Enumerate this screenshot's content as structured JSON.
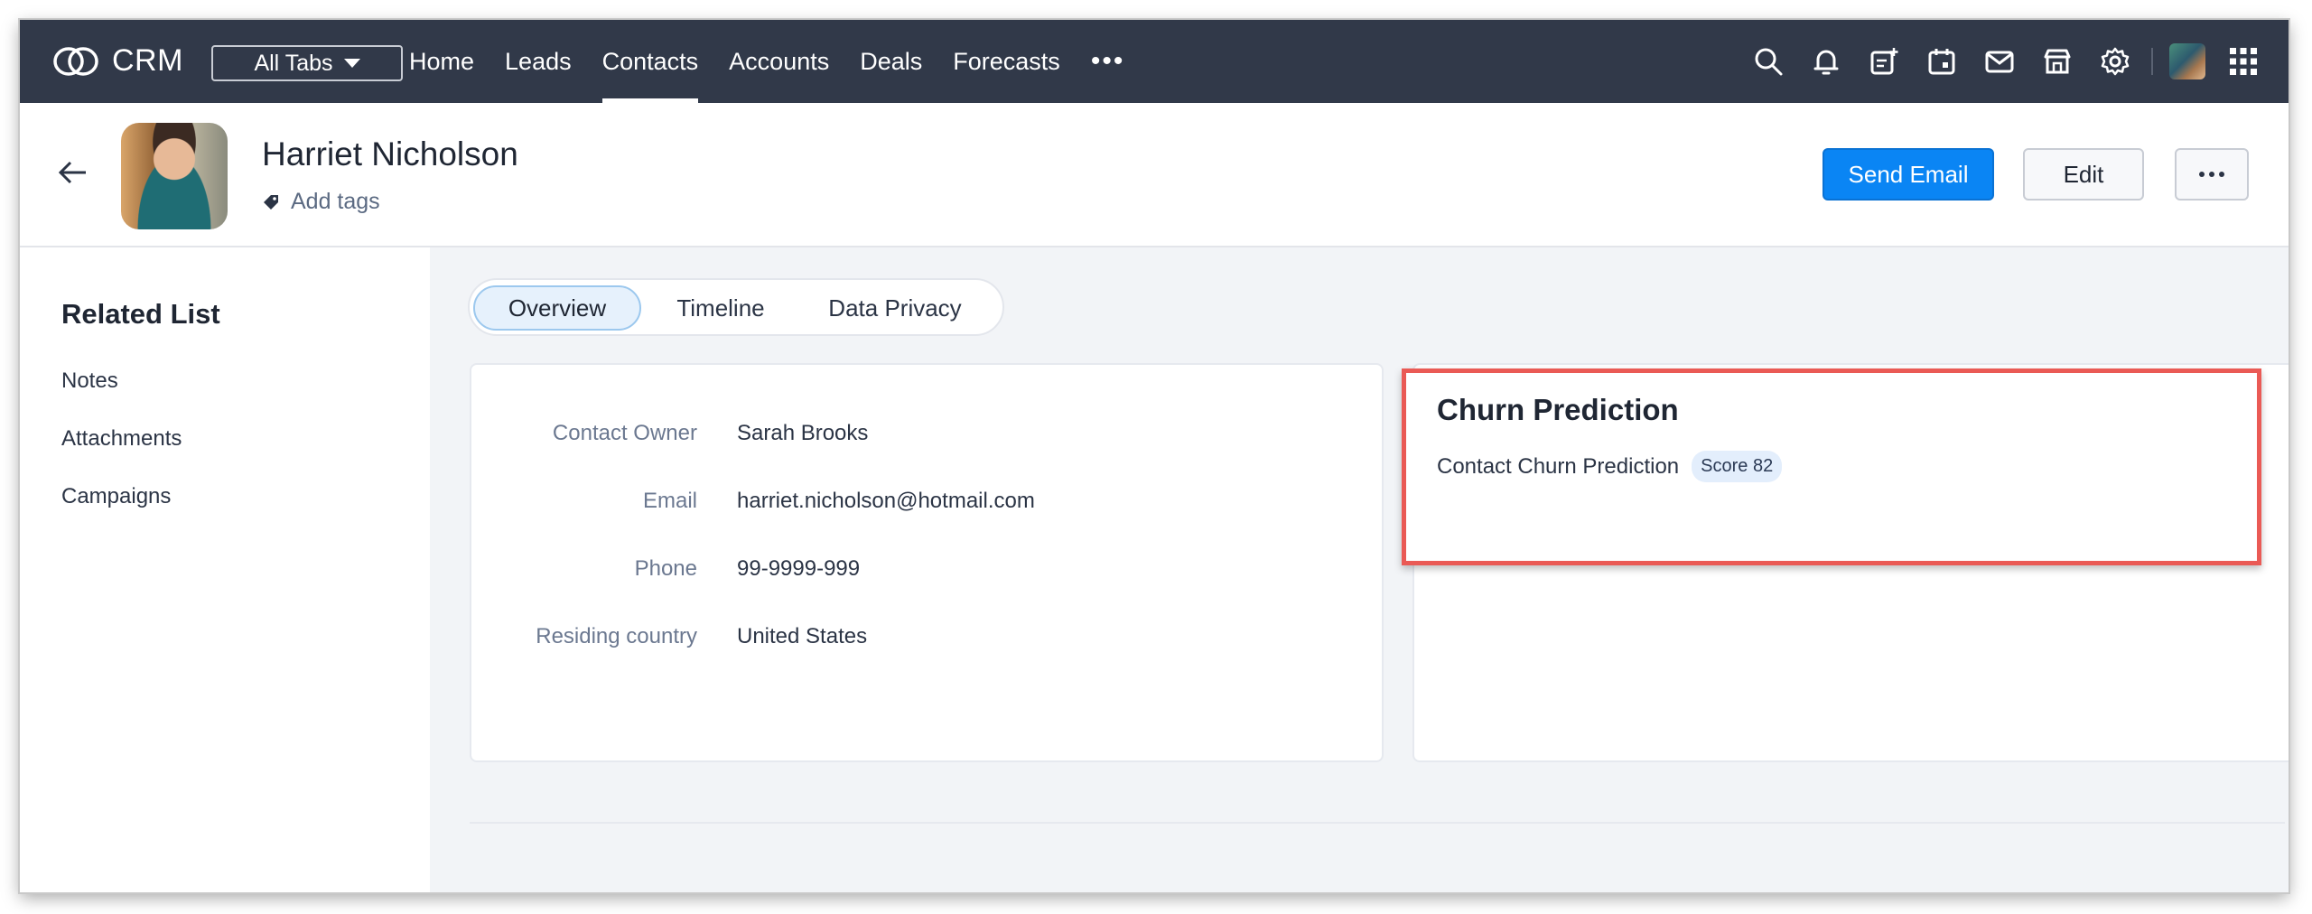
{
  "app": {
    "logo_text": "CRM"
  },
  "topnav": {
    "all_tabs_label": "All Tabs",
    "items": [
      {
        "label": "Home"
      },
      {
        "label": "Leads"
      },
      {
        "label": "Contacts"
      },
      {
        "label": "Accounts"
      },
      {
        "label": "Deals"
      },
      {
        "label": "Forecasts"
      }
    ],
    "more_label": "•••",
    "active": "Contacts",
    "icons": [
      "search-icon",
      "bell-icon",
      "add-note-icon",
      "calendar-icon",
      "mail-icon",
      "marketplace-icon",
      "gear-icon",
      "profile-avatar",
      "apps-grid-icon"
    ]
  },
  "record": {
    "name": "Harriet Nicholson",
    "add_tags_label": "Add tags",
    "send_email_label": "Send Email",
    "edit_label": "Edit",
    "more_label": "•••"
  },
  "related_list": {
    "title": "Related List",
    "items": [
      "Notes",
      "Attachments",
      "Campaigns"
    ]
  },
  "tabs": {
    "items": [
      "Overview",
      "Timeline",
      "Data Privacy"
    ],
    "active": "Overview"
  },
  "fields": [
    {
      "label": "Contact Owner",
      "value": "Sarah Brooks"
    },
    {
      "label": "Email",
      "value": "harriet.nicholson@hotmail.com"
    },
    {
      "label": "Phone",
      "value": "99-9999-999"
    },
    {
      "label": "Residing country",
      "value": "United States"
    }
  ],
  "churn": {
    "title": "Churn Prediction",
    "row_label": "Contact Churn Prediction",
    "score_badge": "Score 82"
  },
  "colors": {
    "topbar": "#313949",
    "primary_button": "#0a85f4",
    "highlight_border": "#ea5a55",
    "content_bg": "#f2f4f7"
  }
}
